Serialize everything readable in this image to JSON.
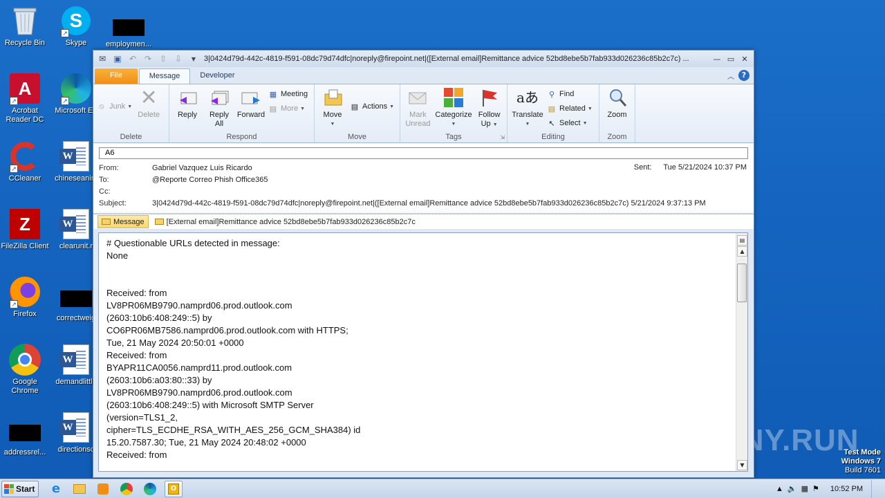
{
  "desktop": {
    "icons": [
      {
        "label": "Recycle Bin"
      },
      {
        "label": "Skype"
      },
      {
        "label": "employmen..."
      },
      {
        "label": "Acrobat Reader DC"
      },
      {
        "label": "Microsoft Ed"
      },
      {
        "label": "CCleaner"
      },
      {
        "label": "chineseanim"
      },
      {
        "label": "FileZilla Client"
      },
      {
        "label": "clearunit.r"
      },
      {
        "label": "Firefox"
      },
      {
        "label": "correctweig"
      },
      {
        "label": "Google Chrome"
      },
      {
        "label": "demandlittle"
      },
      {
        "label": "addressrel..."
      },
      {
        "label": "directionsc"
      }
    ],
    "watermark": "ANY.RUN",
    "test_mode": {
      "line1": "Test Mode",
      "line2": "Windows 7",
      "line3": "Build 7601"
    }
  },
  "window": {
    "title": "3|0424d79d-442c-4819-f591-08dc79d74dfc|noreply@firepoint.net|([External email]Remittance advice 52bd8ebe5b7fab933d026236c85b2c7c) ...",
    "tabs": [
      "File",
      "Message",
      "Developer"
    ],
    "active_tab": "Message",
    "ribbon": {
      "delete_group": {
        "name": "Delete",
        "junk": "Junk",
        "delete": "Delete"
      },
      "respond_group": {
        "name": "Respond",
        "reply": "Reply",
        "reply_all_1": "Reply",
        "reply_all_2": "All",
        "forward": "Forward",
        "meeting": "Meeting",
        "more": "More"
      },
      "move_group": {
        "name": "Move",
        "move": "Move",
        "actions": "Actions"
      },
      "tags_group": {
        "name": "Tags",
        "mark_unread_1": "Mark",
        "mark_unread_2": "Unread",
        "categorize": "Categorize",
        "follow_up_1": "Follow",
        "follow_up_2": "Up"
      },
      "editing_group": {
        "name": "Editing",
        "translate": "Translate",
        "find": "Find",
        "related": "Related",
        "select": "Select"
      },
      "zoom_group": {
        "name": "Zoom",
        "zoom": "Zoom"
      }
    },
    "header": {
      "infobar": "A6",
      "from_label": "From:",
      "from_value": "Gabriel Vazquez Luis Ricardo",
      "to_label": "To:",
      "to_value": "@Reporte Correo Phish Office365",
      "cc_label": "Cc:",
      "cc_value": "",
      "subject_label": "Subject:",
      "subject_value": "3|0424d79d-442c-4819-f591-08dc79d74dfc|noreply@firepoint.net|([External email]Remittance advice 52bd8ebe5b7fab933d026236c85b2c7c) 5/21/2024 9:37:13 PM",
      "sent_label": "Sent:",
      "sent_value": "Tue 5/21/2024 10:37 PM"
    },
    "attachments": [
      {
        "label": "Message"
      },
      {
        "label": "[External email]Remittance advice 52bd8ebe5b7fab933d026236c85b2c7c"
      }
    ],
    "body_lines": [
      "# Questionable URLs detected in message:",
      "None",
      "",
      "",
      "Received: from",
      "LV8PR06MB9790.namprd06.prod.outlook.com",
      "(2603:10b6:408:249::5) by",
      "CO6PR06MB7586.namprd06.prod.outlook.com with HTTPS;",
      "Tue, 21 May 2024 20:50:01 +0000",
      "Received: from",
      "BYAPR11CA0056.namprd11.prod.outlook.com",
      "(2603:10b6:a03:80::33) by",
      "LV8PR06MB9790.namprd06.prod.outlook.com",
      "(2603:10b6:408:249::5) with Microsoft SMTP Server",
      "(version=TLS1_2,",
      "cipher=TLS_ECDHE_RSA_WITH_AES_256_GCM_SHA384) id",
      "15.20.7587.30; Tue, 21 May 2024 20:48:02 +0000",
      "Received: from"
    ]
  },
  "taskbar": {
    "start_label": "Start",
    "clock": "10:52 PM"
  }
}
